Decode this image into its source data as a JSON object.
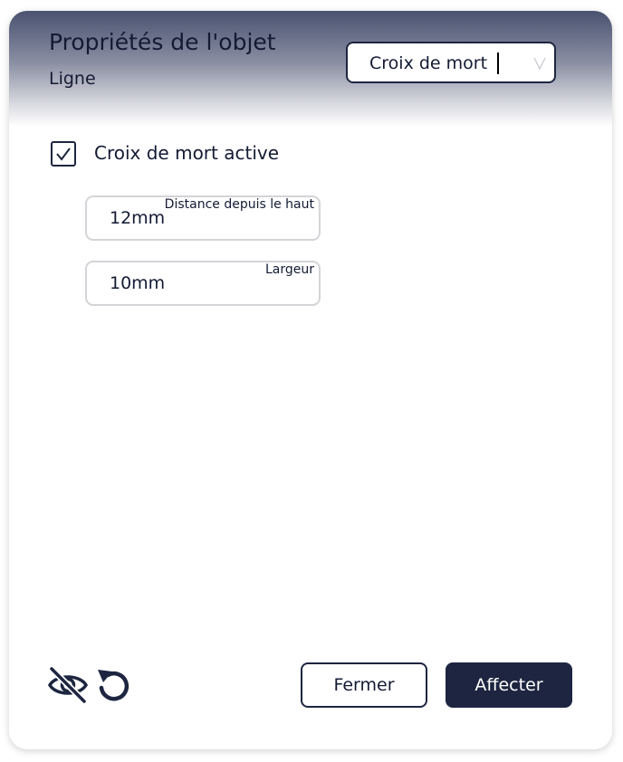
{
  "header": {
    "title": "Propriétés de l'objet",
    "subtitle": "Ligne",
    "type_select": {
      "value": "Croix de mort"
    }
  },
  "crop_mark": {
    "checkbox_label": "Croix de mort active",
    "checked": true,
    "fields": [
      {
        "label": "Distance depuis le haut",
        "value": "12mm"
      },
      {
        "label": "Largeur",
        "value": "10mm"
      }
    ]
  },
  "footer": {
    "icons": [
      "eye-slash-icon",
      "undo-icon"
    ],
    "close_label": "Fermer",
    "apply_label": "Affecter"
  },
  "colors": {
    "primary": "#1d2540",
    "text": "#141a33",
    "field_border": "#d4d4d8"
  }
}
